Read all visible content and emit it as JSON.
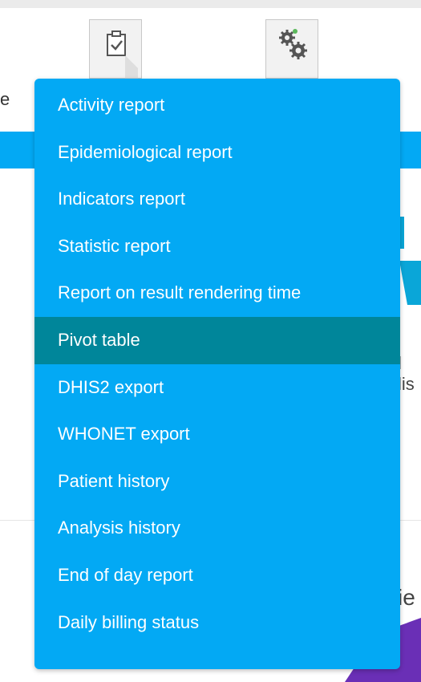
{
  "toolbar": {
    "icons": [
      "clipboard-check-icon",
      "gears-icon"
    ]
  },
  "background": {
    "left_fragment": "e",
    "right_fragment_1": "l lis",
    "right_fragment_2": "ie"
  },
  "menu": {
    "items": [
      {
        "label": "Activity report",
        "active": false
      },
      {
        "label": "Epidemiological report",
        "active": false
      },
      {
        "label": "Indicators report",
        "active": false
      },
      {
        "label": "Statistic report",
        "active": false
      },
      {
        "label": "Report on result rendering time",
        "active": false
      },
      {
        "label": "Pivot table",
        "active": true
      },
      {
        "label": "DHIS2 export",
        "active": false
      },
      {
        "label": "WHONET export",
        "active": false
      },
      {
        "label": "Patient history",
        "active": false
      },
      {
        "label": "Analysis history",
        "active": false
      },
      {
        "label": "End of day report",
        "active": false
      },
      {
        "label": "Daily billing status",
        "active": false
      }
    ]
  },
  "colors": {
    "menu_bg": "#03a9f4",
    "menu_active": "#00869a",
    "menu_text": "#ffffff"
  }
}
